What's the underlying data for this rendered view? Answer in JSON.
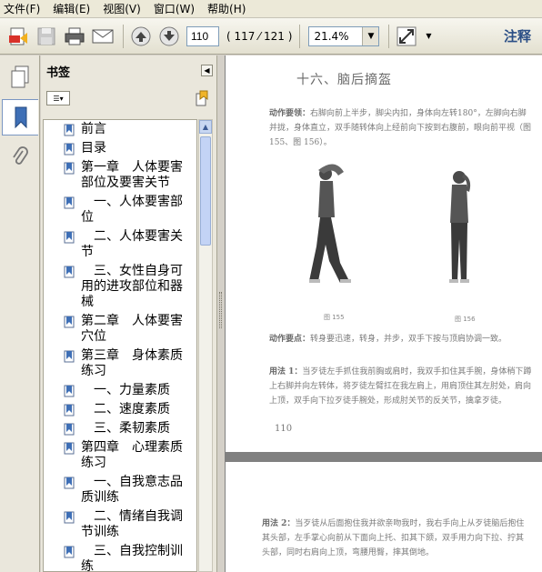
{
  "menu": [
    "文件(F)",
    "编辑(E)",
    "视图(V)",
    "窗口(W)",
    "帮助(H)"
  ],
  "toolbar": {
    "current_page": "110",
    "page_count": "( 117 ⁄ 121 )",
    "zoom": "21.4%",
    "annotate_label": "注释"
  },
  "panel": {
    "title": "书签",
    "bookmarks": [
      "前言",
      "目录",
      "第一章　人体要害部位及要害关节",
      "　一、人体要害部位",
      "　二、人体要害关节",
      "　三、女性自身可用的进攻部位和器械",
      "第二章　人体要害穴位",
      "第三章　身体素质练习",
      "　一、力量素质",
      "　二、速度素质",
      "　三、柔韧素质",
      "第四章　心理素质练习",
      "　一、自我意志品质训练",
      "　二、情绪自我调节训练",
      "　三、自我控制训练"
    ]
  },
  "document": {
    "page1": {
      "title": "十六、脑后摘盔",
      "essentials_label": "动作要领：",
      "essentials_text": "右脚向前上半步，脚尖内扣，身体向左转180°，左脚向右脚并拢，身体直立，双手随转体向上经前向下按到右腹前，眼向前平视（图 155、图 156）。",
      "fig1_caption": "图 155",
      "fig2_caption": "图 156",
      "points_label": "动作要点：",
      "points_text": "转身要迅速，转身，并步，双手下按与顶肩协调一致。",
      "use_label": "用法 1：",
      "use_text": "当歹徒左手抓住我前胸或肩时，我双手扣住其手腕，身体稍下蹲上右脚并向左转体，将歹徒左臂扛在我左肩上，用肩顶住其左肘处，肩向上顶，双手向下拉歹徒手腕处，形成肘关节的反关节，擒拿歹徒。",
      "page_number": "110"
    },
    "page2": {
      "use_label": "用法 2：",
      "use_text": "当歹徒从后面抱住我并欲亲吻我时，我右手向上从歹徒脑后抱住其头部，左手掌心向前从下面向上托、扣其下颌，双手用力向下拉、拧其头部，同时右肩向上顶，弯腰甩臀，摔其倒地。"
    }
  }
}
